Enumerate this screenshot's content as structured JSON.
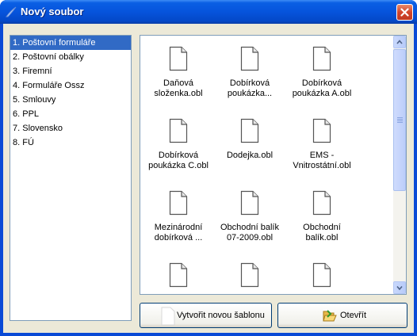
{
  "window": {
    "title": "Nový soubor"
  },
  "categories": [
    {
      "label": "1. Poštovní formuláře",
      "selected": true
    },
    {
      "label": "2. Poštovní obálky",
      "selected": false
    },
    {
      "label": "3. Firemní",
      "selected": false
    },
    {
      "label": "4. Formuláře Ossz",
      "selected": false
    },
    {
      "label": "5. Smlouvy",
      "selected": false
    },
    {
      "label": "6. PPL",
      "selected": false
    },
    {
      "label": "7. Slovensko",
      "selected": false
    },
    {
      "label": "8. FÚ",
      "selected": false
    }
  ],
  "files": [
    {
      "line1": "Daňová",
      "line2": "složenka.obl"
    },
    {
      "line1": "Dobírková",
      "line2": "poukázka..."
    },
    {
      "line1": "Dobírková",
      "line2": "poukázka A.obl"
    },
    {
      "line1": "Dobírková",
      "line2": "poukázka C.obl"
    },
    {
      "line1": "Dodejka.obl",
      "line2": ""
    },
    {
      "line1": "EMS -",
      "line2": "Vnitrostátní.obl"
    },
    {
      "line1": "Mezinárodní",
      "line2": "dobírková ..."
    },
    {
      "line1": "Obchodní balík",
      "line2": "07-2009.obl"
    },
    {
      "line1": "Obchodní",
      "line2": "balík.obl"
    },
    {
      "line1": "",
      "line2": ""
    },
    {
      "line1": "",
      "line2": ""
    },
    {
      "line1": "",
      "line2": ""
    }
  ],
  "buttons": {
    "new_template": "Vytvořit novou šablonu",
    "open": "Otevřít"
  }
}
